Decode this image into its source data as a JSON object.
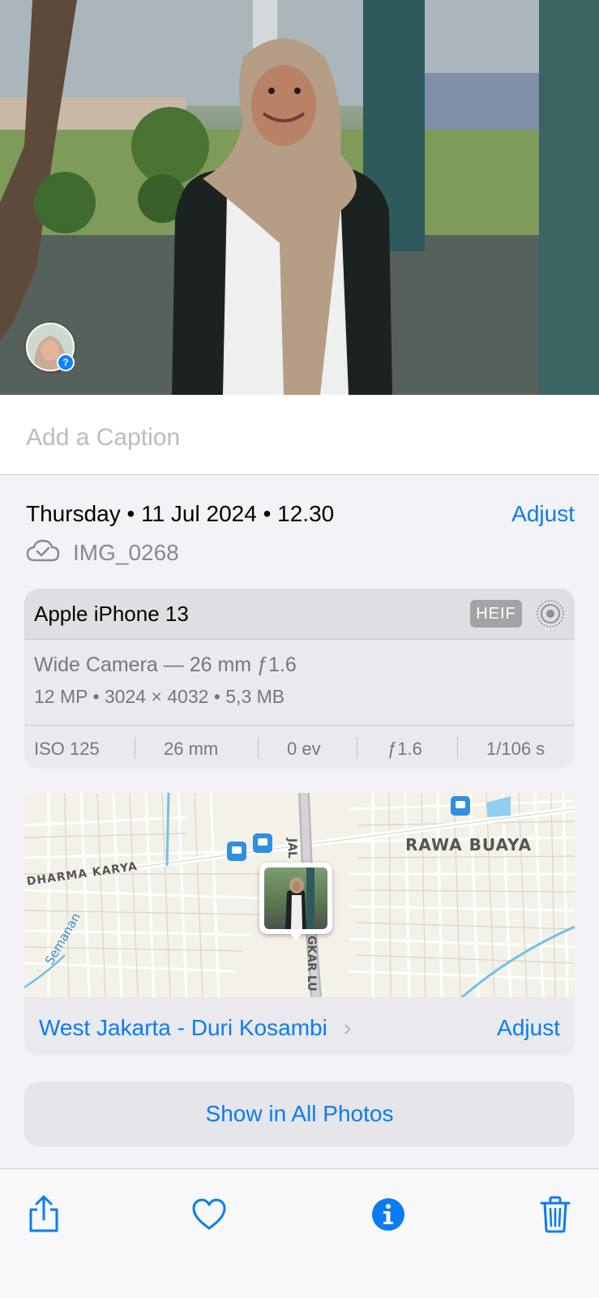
{
  "caption": {
    "placeholder": "Add a Caption"
  },
  "info": {
    "datetime": "Thursday • 11 Jul 2024 • 12.30",
    "adjust_label": "Adjust",
    "cloud_icon": "icloud-check-icon",
    "filename": "IMG_0268"
  },
  "camera": {
    "device": "Apple iPhone 13",
    "format_badge": "HEIF",
    "live_icon": "live-photo-icon",
    "lens": "Wide Camera — 26 mm ƒ1.6",
    "specs": "12 MP  •  3024 × 4032  •  5,3 MB",
    "exif": {
      "iso": "ISO 125",
      "focal": "26 mm",
      "ev": "0 ev",
      "aperture": "ƒ1.6",
      "shutter": "1/106 s"
    }
  },
  "map": {
    "labels": {
      "rawa_buaya": "RAWA BUAYA",
      "dharma_karya": "DHARMA KARYA",
      "semanan": "Semanan",
      "jal": "JAL",
      "gkarlu": "GKAR LU"
    },
    "location": "West Jakarta - Duri Kosambi",
    "adjust_label": "Adjust"
  },
  "actions": {
    "show_all": "Show in All Photos"
  },
  "toolbar": {
    "share_icon": "share-icon",
    "favorite_icon": "heart-icon",
    "info_icon": "info-icon",
    "delete_icon": "trash-icon"
  },
  "colors": {
    "accent": "#0a7cf2",
    "background": "#f2f2f7",
    "card": "#e9e9ee"
  }
}
